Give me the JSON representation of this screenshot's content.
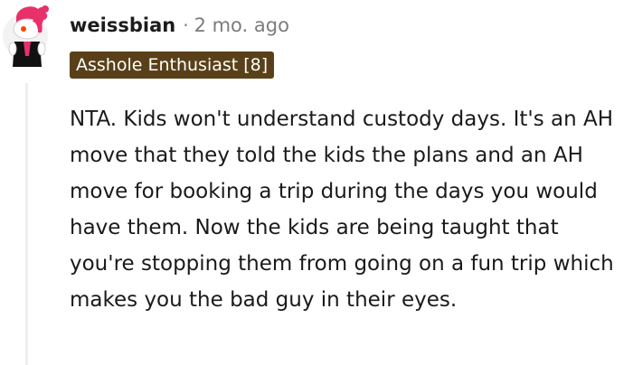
{
  "comment": {
    "username": "weissbian",
    "separator": "·",
    "timestamp": "2 mo. ago",
    "flair": "Asshole Enthusiast [8]",
    "body": "NTA. Kids won't understand custody days. It's an AH move that they told the kids the plans and an AH move for booking a trip during the days you would have them. Now the kids are being taught that you're stopping them from going on a fun trip which makes you the bad guy in their eyes."
  },
  "colors": {
    "flair_bg": "#5a4019",
    "flair_text": "#ffffff",
    "username": "#1c1c1c",
    "meta": "#7c7c7c",
    "thread_line": "#edeff1",
    "avatar_hair": "#e8306a",
    "avatar_shirt": "#111111"
  },
  "icons": {
    "avatar": "reddit-snoo-avatar"
  }
}
